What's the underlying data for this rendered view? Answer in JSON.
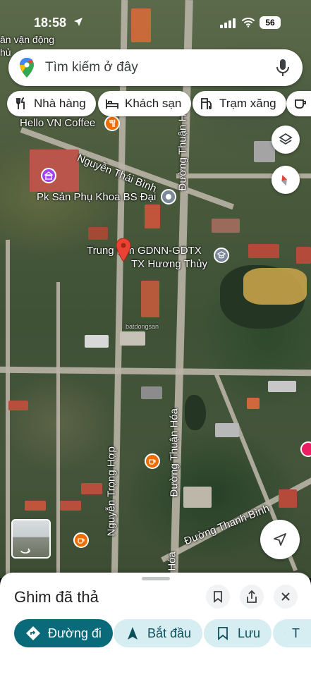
{
  "status_bar": {
    "time": "18:58",
    "network_badge": "56"
  },
  "search": {
    "placeholder": "Tìm kiếm ở đây"
  },
  "chips": [
    {
      "label": "Nhà hàng",
      "icon": "restaurant-icon"
    },
    {
      "label": "Khách sạn",
      "icon": "hotel-icon"
    },
    {
      "label": "Trạm xăng",
      "icon": "gas-station-icon"
    }
  ],
  "map": {
    "labels": {
      "partial_top": "ân vận động",
      "partial_top2": "hủ",
      "coffee": "Hello VN Coffee",
      "clinic": "Pk Sản Phụ Khoa BS Đại",
      "center_line1": "Trung tâm GDNN-GDTX",
      "center_line2": "TX Hương Thủy",
      "watermark": "batdongsan"
    },
    "roads": {
      "nguyen_thai_binh": "Nguyễn Thái Bình",
      "duong_thuan_hoa_top": "Đường Thuận Hóa",
      "duong_thuan_hoa_mid": "Đường Thuận Hóa",
      "nguyen_trong_hop": "Nguyễn Trọng Hợp",
      "duong_thanh_binh": "Đường Thanh Bình",
      "thuan_hoa_bottom": "ận Hóa"
    }
  },
  "sheet": {
    "title": "Ghim đã thả",
    "actions": [
      {
        "label": "Đường đi",
        "icon": "directions-icon"
      },
      {
        "label": "Bắt đầu",
        "icon": "navigation-arrow-icon"
      },
      {
        "label": "Lưu",
        "icon": "bookmark-icon"
      },
      {
        "label": "T",
        "icon": "flag-icon"
      }
    ]
  },
  "colors": {
    "primary": "#0b6a7a",
    "secondary": "#d6eef2",
    "pin": "#ea4335",
    "poi_orange": "#ef6c00",
    "poi_purple": "#a142f4",
    "poi_gray": "#7a8a99"
  }
}
